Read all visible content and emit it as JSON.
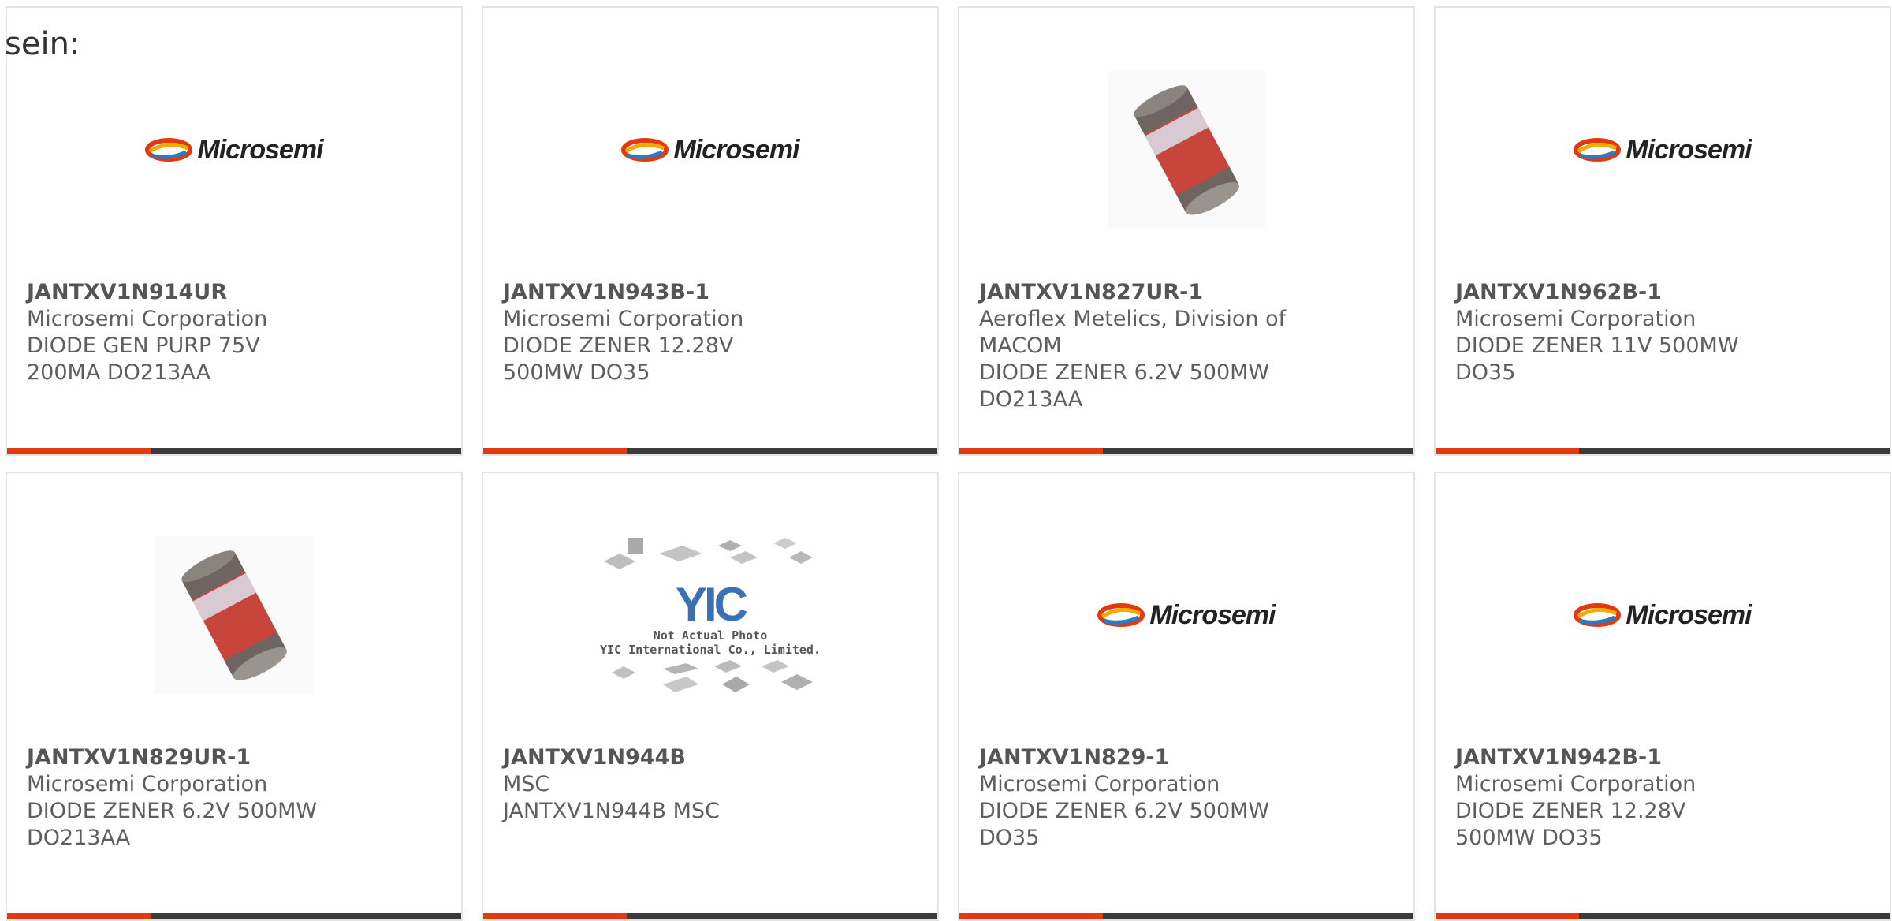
{
  "intro_text": "sein:",
  "accent_color": "#e23a0e",
  "bar_color": "#3a3a3a",
  "logo_text": "Microsemi",
  "yic_caption_line1": "Not Actual Photo",
  "yic_caption_line2": "YIC International Co., Limited.",
  "yic_mark": "YIC",
  "products": [
    {
      "part": "JANTXV1N914UR",
      "manufacturer": "Microsemi Corporation",
      "description": "DIODE GEN PURP 75V 200MA DO213AA",
      "image": "microsemi-logo"
    },
    {
      "part": "JANTXV1N943B-1",
      "manufacturer": "Microsemi Corporation",
      "description": "DIODE ZENER 12.28V 500MW DO35",
      "image": "microsemi-logo"
    },
    {
      "part": "JANTXV1N827UR-1",
      "manufacturer": "Aeroflex Metelics, Division of MACOM",
      "description": "DIODE ZENER 6.2V 500MW DO213AA",
      "image": "diode-photo"
    },
    {
      "part": "JANTXV1N962B-1",
      "manufacturer": "Microsemi Corporation",
      "description": "DIODE ZENER 11V 500MW DO35",
      "image": "microsemi-logo"
    },
    {
      "part": "JANTXV1N829UR-1",
      "manufacturer": "Microsemi Corporation",
      "description": "DIODE ZENER 6.2V 500MW DO213AA",
      "image": "diode-photo"
    },
    {
      "part": "JANTXV1N944B",
      "manufacturer": "MSC",
      "description": "JANTXV1N944B MSC",
      "image": "yic-placeholder"
    },
    {
      "part": "JANTXV1N829-1",
      "manufacturer": "Microsemi Corporation",
      "description": "DIODE ZENER 6.2V 500MW DO35",
      "image": "microsemi-logo"
    },
    {
      "part": "JANTXV1N942B-1",
      "manufacturer": "Microsemi Corporation",
      "description": "DIODE ZENER 12.28V 500MW DO35",
      "image": "microsemi-logo"
    }
  ]
}
